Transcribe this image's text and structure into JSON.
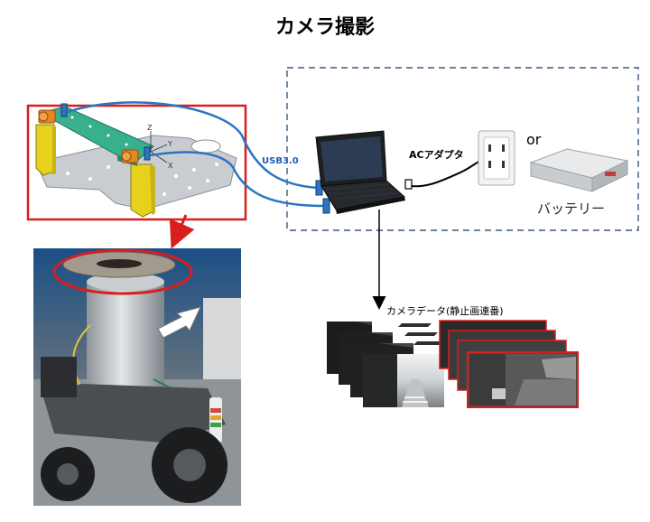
{
  "title": "カメラ撮影",
  "labels": {
    "usb": "USB3.0",
    "ac_adapter": "ACアダプタ",
    "or": "or",
    "battery": "バッテリー",
    "camera_data": "カメラデータ(静止画連番)"
  },
  "colors": {
    "red_outline": "#d81e1e",
    "cable_blue": "#2a74c2",
    "dashed_border": "#3a5a80",
    "plate_green": "#38b08e",
    "bracket_yellow": "#e6d21c"
  }
}
